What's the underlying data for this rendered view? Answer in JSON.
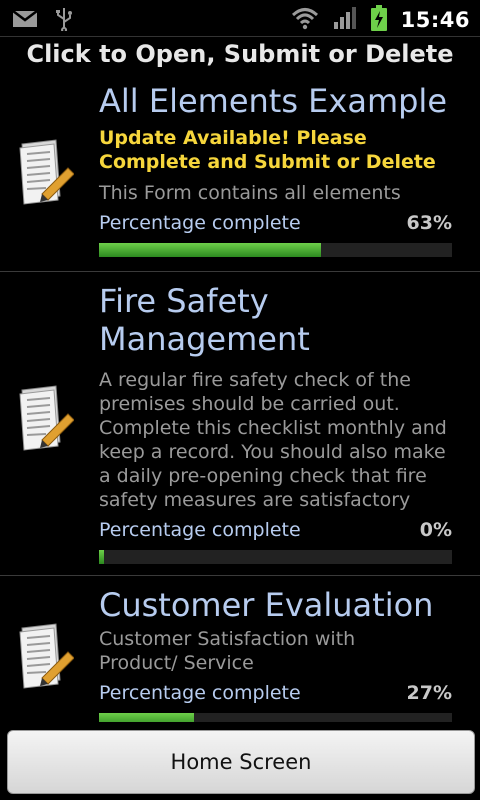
{
  "status_bar": {
    "left_icons": [
      "gmail-icon",
      "usb-icon"
    ],
    "right_icons": [
      "wifi-icon",
      "signal-icon",
      "battery-charging-icon"
    ],
    "time": "15:46"
  },
  "header": {
    "title": "Click to Open, Submit or Delete"
  },
  "forms": [
    {
      "title": "All Elements Example",
      "update_notice": "Update Available! Please Complete and Submit or Delete",
      "description": "This Form contains all elements",
      "percentage_label": "Percentage complete",
      "percentage_text": "63%",
      "progress": 0.63,
      "icon": "form-edit-icon"
    },
    {
      "title": "Fire Safety Management",
      "update_notice": "",
      "description": "A regular fire safety check of the premises should be carried out. Complete this checklist monthly and keep a record. You should also make a daily pre-opening check that fire safety measures are satisfactory",
      "percentage_label": "Percentage complete",
      "percentage_text": "0%",
      "progress": 0.0,
      "icon": "form-edit-icon"
    },
    {
      "title": "Customer Evaluation",
      "update_notice": "",
      "description": "Customer Satisfaction with Product/ Service",
      "percentage_label": "Percentage complete",
      "percentage_text": "27%",
      "progress": 0.27,
      "icon": "form-edit-icon"
    }
  ],
  "footer": {
    "home_button_label": "Home Screen"
  },
  "colors": {
    "title_blue": "#b7ccef",
    "update_yellow": "#f6d63c",
    "progress_green": "#4fb634"
  }
}
